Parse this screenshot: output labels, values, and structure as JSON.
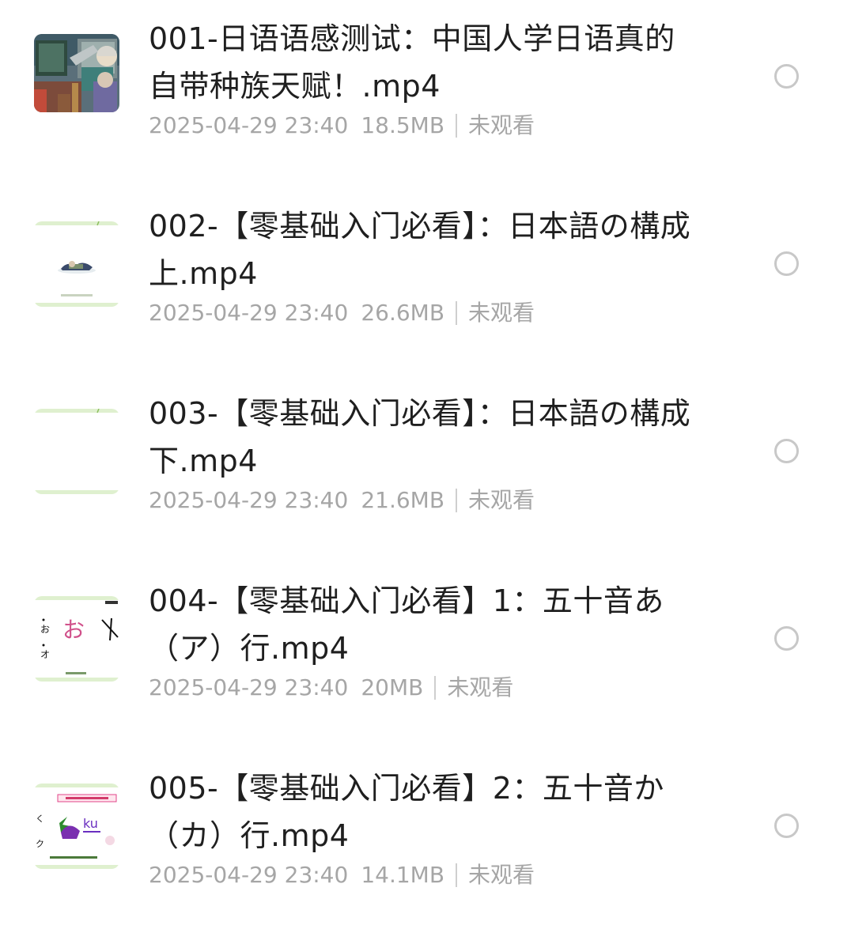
{
  "items": [
    {
      "title": "001-日语语感测试：中国人学日语真的自带种族天赋！.mp4",
      "date": "2025-04-29 23:40",
      "size": "18.5MB",
      "status": "未观看",
      "thumbnail_icon": "anime-scene-thumbnail"
    },
    {
      "title": "002-【零基础入门必看】：日本語の構成 上.mp4",
      "date": "2025-04-29 23:40",
      "size": "26.6MB",
      "status": "未观看",
      "thumbnail_icon": "lesson-slide-thumbnail"
    },
    {
      "title": "003-【零基础入门必看】：日本語の構成 下.mp4",
      "date": "2025-04-29 23:40",
      "size": "21.6MB",
      "status": "未观看",
      "thumbnail_icon": "blank-slide-thumbnail"
    },
    {
      "title": "004-【零基础入门必看】1：五十音あ（ア）行.mp4",
      "date": "2025-04-29 23:40",
      "size": "20MB",
      "status": "未观看",
      "thumbnail_icon": "kana-slide-thumbnail",
      "thumbnail_text": {
        "kana_large": "お",
        "kana_small_1": "お",
        "kana_small_2": "オ"
      }
    },
    {
      "title": "005-【零基础入门必看】2：五十音か（カ）行.mp4",
      "date": "2025-04-29 23:40",
      "size": "14.1MB",
      "status": "未观看",
      "thumbnail_icon": "kana-slide-thumbnail",
      "thumbnail_text": {
        "romaji": "ku",
        "kana_small_1": "く",
        "kana_small_2": "ク"
      }
    }
  ],
  "colors": {
    "title": "#1f1f1f",
    "meta": "#a6a6a6",
    "radio_border": "#c8c8c8",
    "thumb_band": "#dff0cf"
  }
}
